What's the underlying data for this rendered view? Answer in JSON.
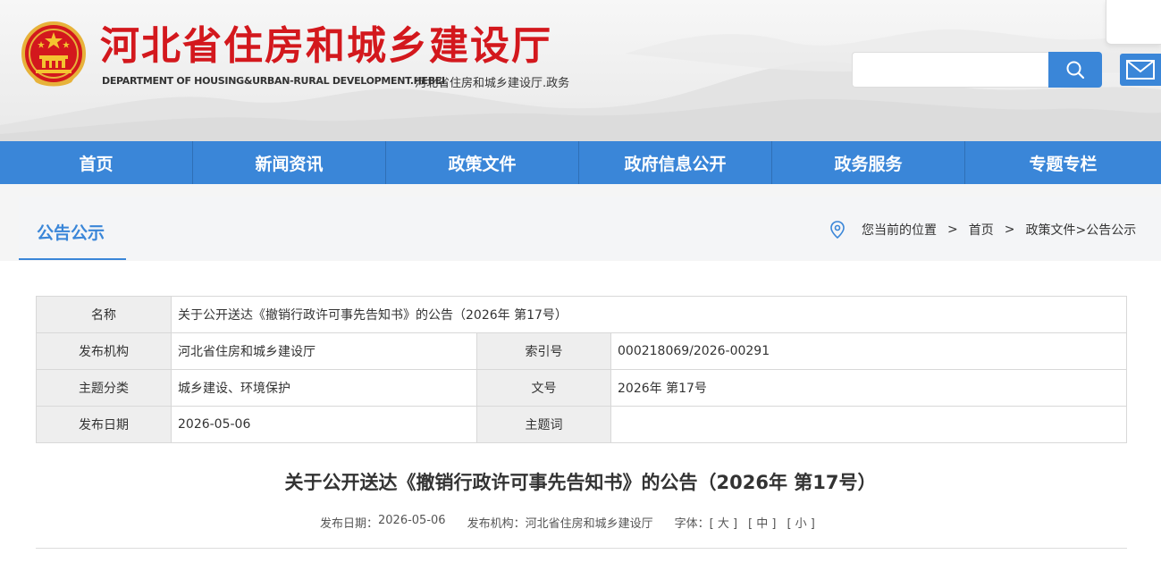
{
  "header": {
    "site_title": "河北省住房和城乡建设厅",
    "site_title_en": "DEPARTMENT OF HOUSING&URBAN-RURAL DEVELOPMENT.HEBEI",
    "site_subtitle": "河北省住房和城乡建设厅.政务",
    "search": {
      "value": "",
      "placeholder": ""
    },
    "search_icon": "search-icon",
    "mail_icon": "mail-icon",
    "emblem_icon": "national-emblem-icon"
  },
  "nav": {
    "items": [
      {
        "label": "首页"
      },
      {
        "label": "新闻资讯"
      },
      {
        "label": "政策文件"
      },
      {
        "label": "政府信息公开"
      },
      {
        "label": "政务服务"
      },
      {
        "label": "专题专栏"
      }
    ]
  },
  "column": {
    "title": "公告公示",
    "location_icon": "location-pin-icon",
    "breadcrumb_prefix": "您当前的位置",
    "separator": ">",
    "crumb_home": "首页",
    "crumb_path": "政策文件>公告公示"
  },
  "info_table": {
    "name_label": "名称",
    "name_value": "关于公开送达《撤销行政许可事先告知书》的公告（2026年 第17号）",
    "issuer_label": "发布机构",
    "issuer_value": "河北省住房和城乡建设厅",
    "index_label": "索引号",
    "index_value": "000218069/2026-00291",
    "topic_label": "主题分类",
    "topic_value": "城乡建设、环境保护",
    "doc_no_label": "文号",
    "doc_no_value": "2026年 第17号",
    "date_label": "发布日期",
    "date_value": "2026-05-06",
    "keyword_label": "主题词",
    "keyword_value": ""
  },
  "article": {
    "title": "关于公开送达《撤销行政许可事先告知书》的公告（2026年 第17号）",
    "meta": {
      "date_label": "发布日期：",
      "date_value": "2026-05-06",
      "issuer_label": "发布机构：",
      "issuer_value": "河北省住房和城乡建设厅",
      "font_label": "字体：",
      "font_large": "[ 大 ]",
      "font_medium": "[ 中 ]",
      "font_small": "[ 小 ]"
    }
  },
  "colors": {
    "primary_blue": "#3a86d8",
    "title_red": "#d3181d",
    "label_bg": "#eeeeee"
  }
}
